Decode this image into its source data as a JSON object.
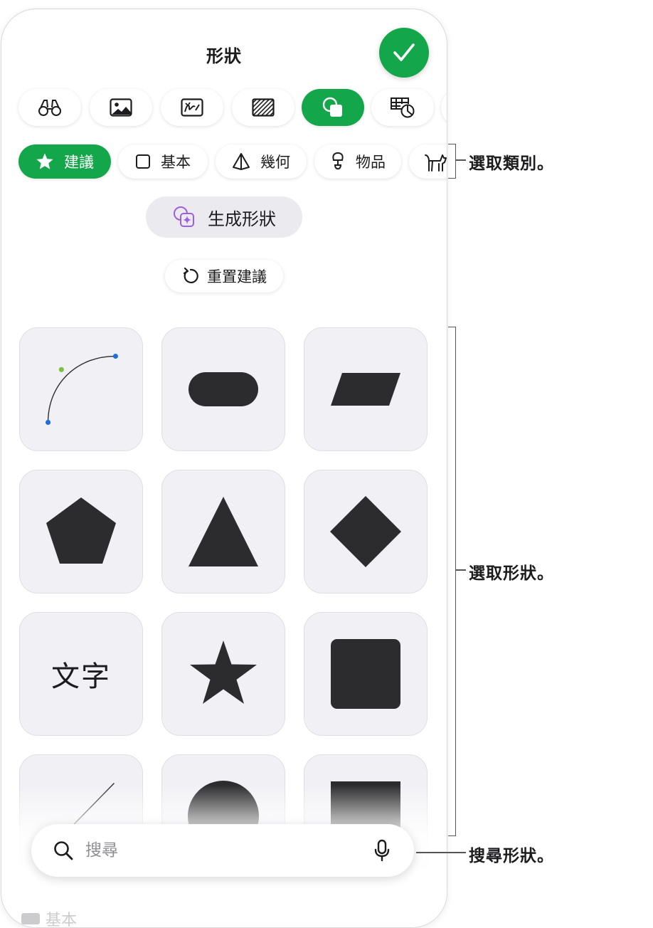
{
  "panel": {
    "title": "形狀",
    "done_button": {
      "icon": "checkmark-icon",
      "color": "#14a64a"
    }
  },
  "toolbar": {
    "items": [
      {
        "icon": "binoculars-icon"
      },
      {
        "icon": "photo-icon"
      },
      {
        "icon": "sketch-icon"
      },
      {
        "icon": "hatch-fill-icon"
      },
      {
        "icon": "shapes-icon",
        "active": true
      },
      {
        "icon": "table-chart-icon"
      }
    ]
  },
  "categories": [
    {
      "label": "建議",
      "icon": "star-icon",
      "active": true
    },
    {
      "label": "基本",
      "icon": "square-icon"
    },
    {
      "label": "幾何",
      "icon": "pyramid-icon"
    },
    {
      "label": "物品",
      "icon": "lamp-icon"
    },
    {
      "label": "",
      "icon": "cat-icon"
    }
  ],
  "actions": {
    "generate_label": "生成形狀",
    "reset_label": "重置建議"
  },
  "shapes": [
    {
      "name": "curve"
    },
    {
      "name": "rounded-rectangle"
    },
    {
      "name": "parallelogram"
    },
    {
      "name": "pentagon"
    },
    {
      "name": "triangle"
    },
    {
      "name": "diamond"
    },
    {
      "name": "text",
      "label": "文字"
    },
    {
      "name": "star"
    },
    {
      "name": "rounded-square"
    },
    {
      "name": "line"
    },
    {
      "name": "circle"
    },
    {
      "name": "square"
    }
  ],
  "below_section": {
    "label": "基本"
  },
  "search": {
    "placeholder": "搜尋"
  },
  "callouts": {
    "category": "選取類別。",
    "shape": "選取形狀。",
    "search": "搜尋形狀。"
  },
  "colors": {
    "accent": "#14a64a",
    "shape_fill": "#2c2c2e",
    "tile_bg": "#f1f1f5",
    "ai_purple": "#9b5fe0"
  }
}
